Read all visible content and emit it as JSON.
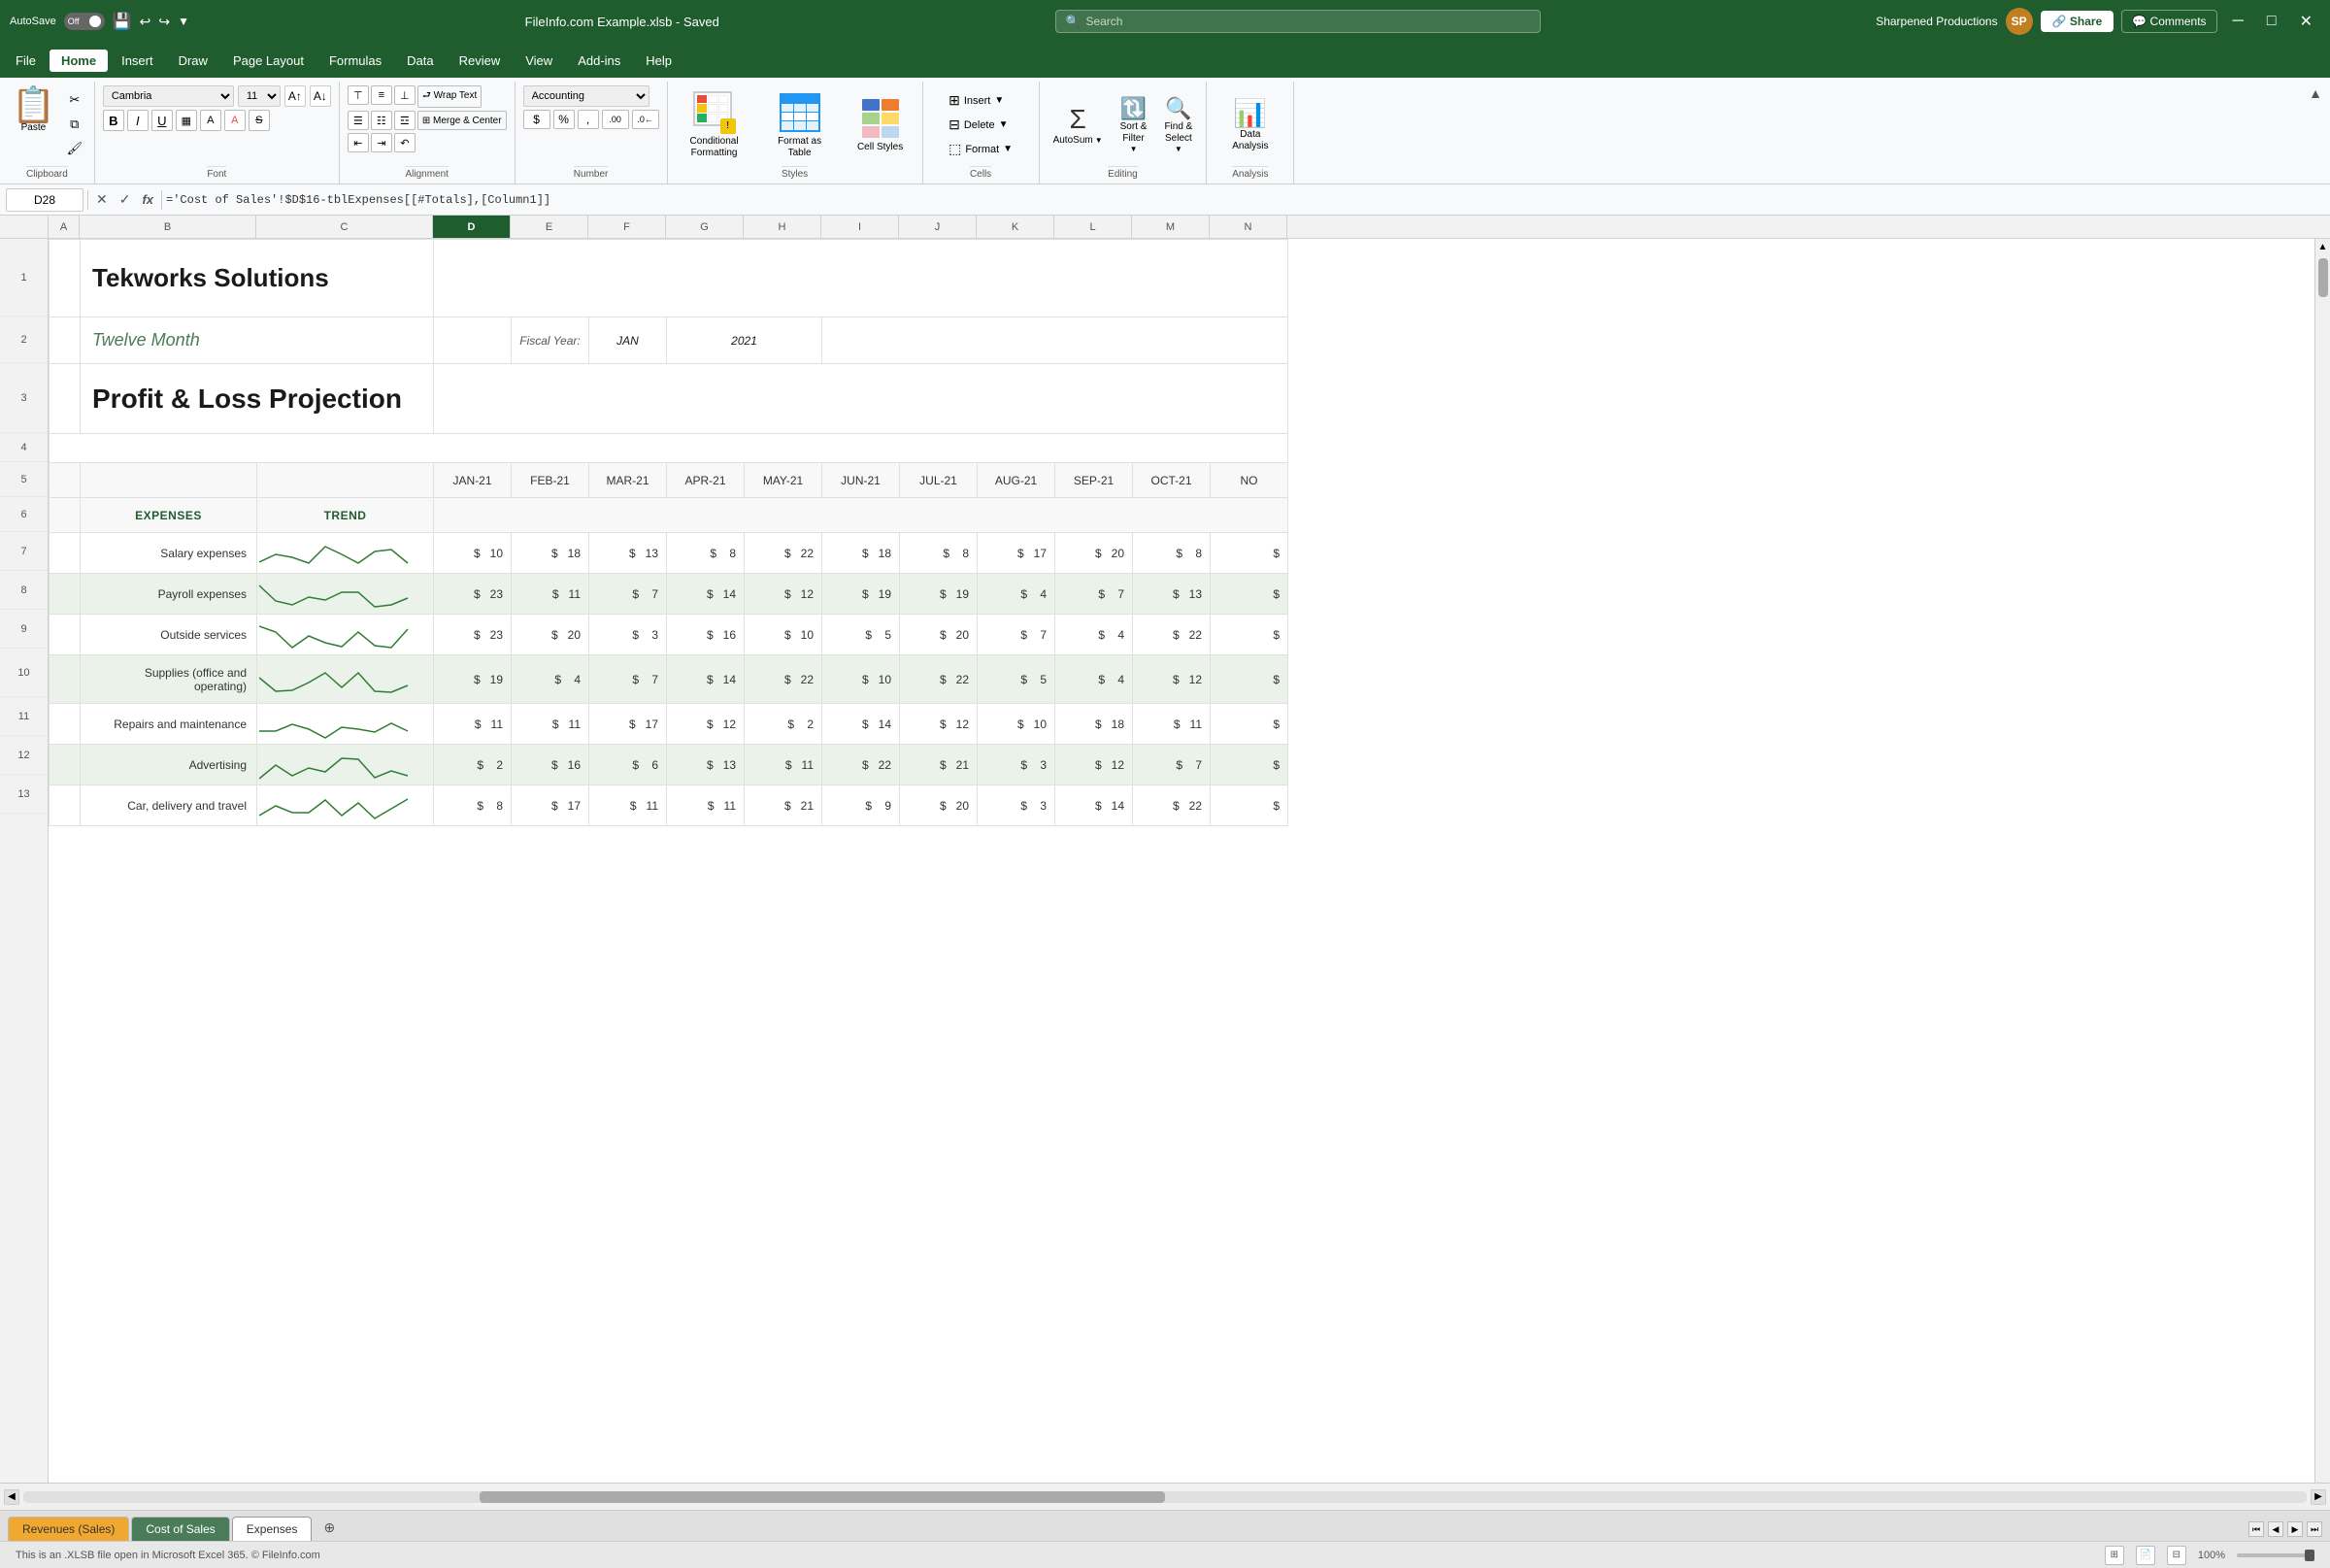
{
  "titleBar": {
    "autosave": "AutoSave",
    "off": "Off",
    "filename": "FileInfo.com Example.xlsb  -  Saved",
    "search_placeholder": "Search",
    "user": "Sharpened Productions",
    "user_initials": "SP",
    "minimize": "─",
    "maximize": "□",
    "close": "✕"
  },
  "menuBar": {
    "items": [
      "File",
      "Home",
      "Insert",
      "Draw",
      "Page Layout",
      "Formulas",
      "Data",
      "Review",
      "View",
      "Add-ins",
      "Help"
    ],
    "active": "Home"
  },
  "ribbon": {
    "clipboard": {
      "label": "Clipboard",
      "paste": "Paste",
      "cut": "✂",
      "copy": "⧉",
      "format_painter": "🖌"
    },
    "font": {
      "label": "Font",
      "name": "Cambria",
      "size": "11",
      "bold": "B",
      "italic": "I",
      "underline": "U",
      "strikethrough": "S",
      "border_btn": "▦",
      "fill_btn": "A",
      "font_color_btn": "A"
    },
    "alignment": {
      "label": "Alignment",
      "top_align": "⊤",
      "mid_align": "≡",
      "bot_align": "⊥",
      "left_align": "☰",
      "center_align": "☰",
      "right_align": "☰",
      "wrap_text": "⮐ Wrap",
      "merge_center": "⊞ Merge",
      "indent_dec": "⇤",
      "indent_inc": "⇥",
      "orientation": "↶"
    },
    "number": {
      "label": "Number",
      "format": "Accounting",
      "dollar_sign": "$",
      "percent_sign": "%",
      "comma": ",",
      "inc_decimal": ".0→",
      "dec_decimal": "←.0"
    },
    "styles": {
      "label": "Styles",
      "conditional_formatting": "Conditional\nFormatting",
      "format_as_table": "Format as\nTable",
      "cell_styles": "Cell Styles"
    },
    "cells": {
      "label": "Cells",
      "insert": "Insert",
      "delete": "Delete",
      "format": "Format"
    },
    "editing": {
      "label": "Editing",
      "sum": "Σ",
      "sort_filter": "Sort &\nFilter",
      "find_select": "Find &\nSelect"
    },
    "analysis": {
      "label": "Analysis",
      "data_analysis": "Data\nAnalysis"
    }
  },
  "formulaBar": {
    "cell_ref": "D28",
    "formula": "='Cost of Sales'!$D$16-tblExpenses[[#Totals],[Column1]]"
  },
  "columns": {
    "headers": [
      "A",
      "B",
      "C",
      "D",
      "E",
      "F",
      "G",
      "H",
      "I",
      "J",
      "K",
      "L",
      "M",
      "N"
    ],
    "active": "D"
  },
  "sheet": {
    "company": "Tekworks Solutions",
    "title_line1": "Twelve Month",
    "title_line2": "Profit & Loss Projection",
    "fiscal_label": "Fiscal Year:",
    "fiscal_month": "JAN",
    "fiscal_year": "2021",
    "months": [
      "JAN-21",
      "FEB-21",
      "MAR-21",
      "APR-21",
      "MAY-21",
      "JUN-21",
      "JUL-21",
      "AUG-21",
      "SEP-21",
      "OCT-21",
      "NO"
    ],
    "expenses_header": "EXPENSES",
    "trend_header": "TREND",
    "rows": [
      {
        "label": "Salary expenses",
        "green": false,
        "values": [
          10,
          18,
          13,
          8,
          22,
          18,
          8,
          17,
          20,
          8
        ]
      },
      {
        "label": "Payroll expenses",
        "green": true,
        "values": [
          23,
          11,
          7,
          14,
          12,
          19,
          19,
          4,
          7,
          13
        ]
      },
      {
        "label": "Outside services",
        "green": false,
        "values": [
          23,
          20,
          3,
          16,
          10,
          5,
          20,
          7,
          4,
          22
        ]
      },
      {
        "label": "Supplies (office and operating)",
        "green": true,
        "values": [
          19,
          4,
          7,
          14,
          22,
          10,
          22,
          5,
          4,
          12
        ]
      },
      {
        "label": "Repairs and maintenance",
        "green": false,
        "values": [
          11,
          11,
          17,
          12,
          2,
          14,
          12,
          10,
          18,
          11
        ]
      },
      {
        "label": "Advertising",
        "green": true,
        "values": [
          2,
          16,
          6,
          13,
          11,
          22,
          21,
          3,
          12,
          7
        ]
      },
      {
        "label": "Car, delivery and travel",
        "green": false,
        "values": [
          8,
          17,
          11,
          11,
          21,
          9,
          20,
          3,
          14,
          22
        ]
      }
    ]
  },
  "tabs": [
    {
      "label": "Revenues (Sales)",
      "style": "revenue-tab"
    },
    {
      "label": "Cost of Sales",
      "style": "cost-tab"
    },
    {
      "label": "Expenses",
      "style": "expenses-tab",
      "active": true
    }
  ],
  "statusBar": {
    "message": "This is an .XLSB file open in Microsoft Excel 365. © FileInfo.com",
    "zoom": "100%"
  },
  "sparklines": [
    [
      10,
      18,
      13,
      8,
      22,
      18,
      8,
      17,
      20,
      8
    ],
    [
      23,
      11,
      7,
      14,
      12,
      19,
      19,
      4,
      7,
      13
    ],
    [
      23,
      20,
      3,
      16,
      10,
      5,
      20,
      7,
      4,
      22
    ],
    [
      19,
      4,
      7,
      14,
      22,
      10,
      22,
      5,
      4,
      12
    ],
    [
      11,
      11,
      17,
      12,
      2,
      14,
      12,
      10,
      18,
      11
    ],
    [
      2,
      16,
      6,
      13,
      11,
      22,
      21,
      3,
      12,
      7
    ],
    [
      8,
      17,
      11,
      11,
      21,
      9,
      20,
      3,
      14,
      22
    ]
  ]
}
